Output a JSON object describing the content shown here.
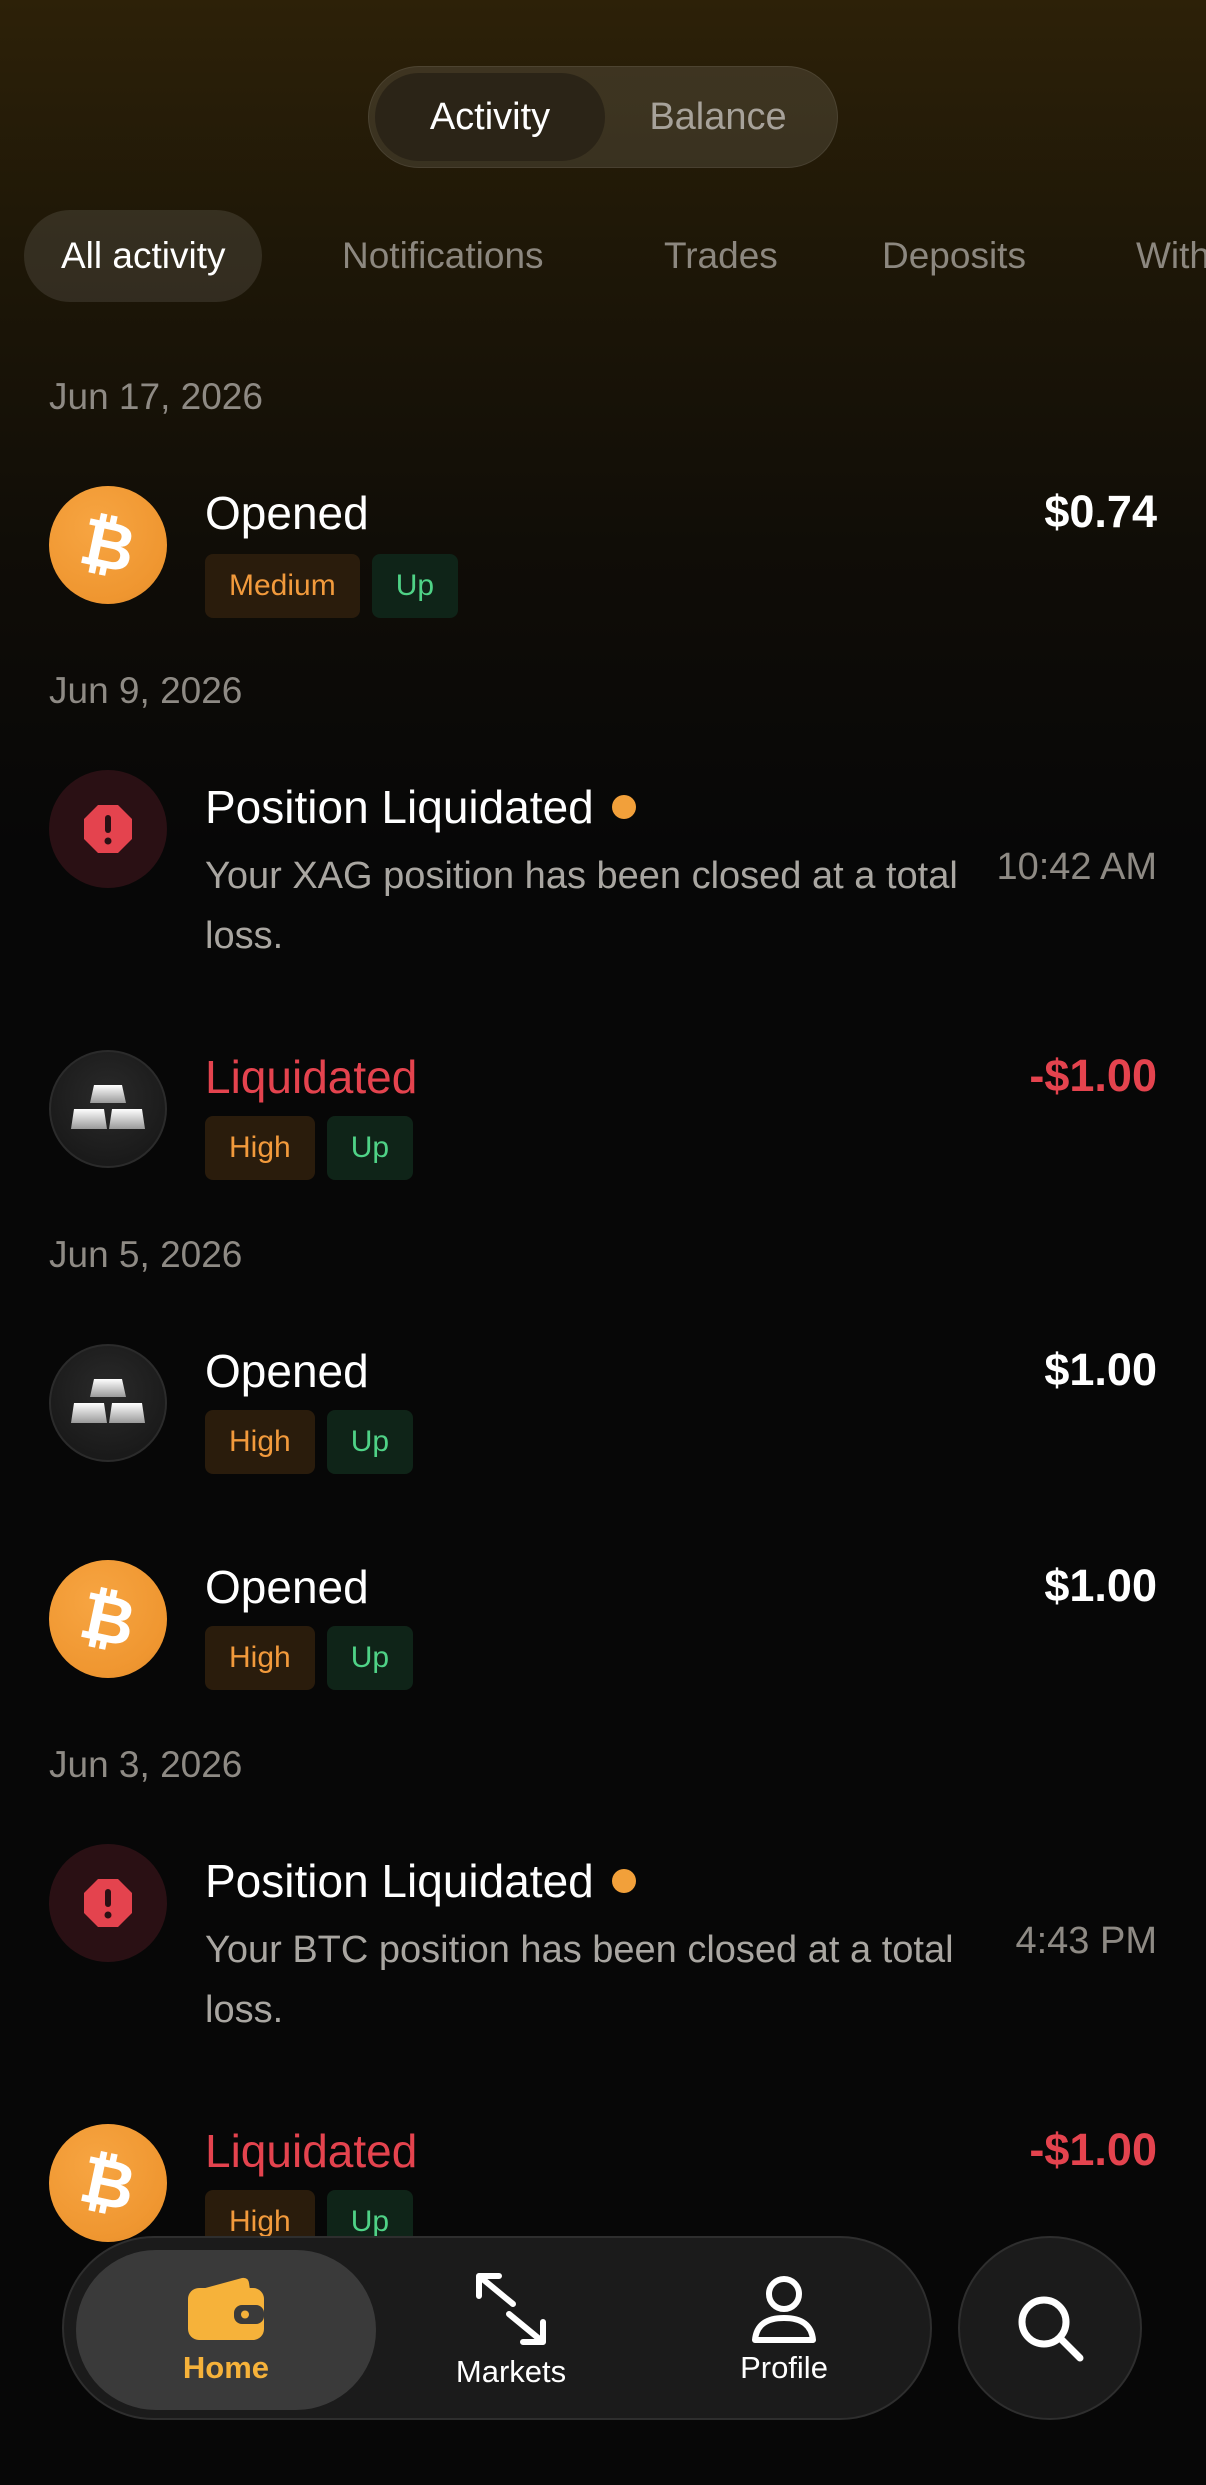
{
  "tabs": {
    "activity": "Activity",
    "balance": "Balance"
  },
  "filters": [
    "All activity",
    "Notifications",
    "Trades",
    "Deposits",
    "Withdrawals"
  ],
  "groups": [
    {
      "date": "Jun 17, 2026"
    },
    {
      "date": "Jun 9, 2026"
    },
    {
      "date": "Jun 5, 2026"
    },
    {
      "date": "Jun 3, 2026"
    }
  ],
  "items": [
    {
      "icon": "bitcoin-icon",
      "title": "Opened",
      "amount": "$0.74",
      "tags": [
        "Medium",
        "Up"
      ]
    },
    {
      "icon": "alert-icon",
      "title": "Position Liquidated",
      "description": "Your XAG position has been closed at a total loss.",
      "time": "10:42 AM",
      "unread": true
    },
    {
      "icon": "silver-bars-icon",
      "title": "Liquidated",
      "amount": "-$1.00",
      "tags": [
        "High",
        "Up"
      ]
    },
    {
      "icon": "silver-bars-icon",
      "title": "Opened",
      "amount": "$1.00",
      "tags": [
        "High",
        "Up"
      ]
    },
    {
      "icon": "bitcoin-icon",
      "title": "Opened",
      "amount": "$1.00",
      "tags": [
        "High",
        "Up"
      ]
    },
    {
      "icon": "alert-icon",
      "title": "Position Liquidated",
      "description": "Your BTC position has been closed at a total loss.",
      "time": "4:43 PM",
      "unread": true
    },
    {
      "icon": "bitcoin-icon",
      "title": "Liquidated",
      "amount": "-$1.00",
      "tags": [
        "High",
        "Up"
      ]
    }
  ],
  "nav": {
    "home": "Home",
    "markets": "Markets",
    "profile": "Profile"
  },
  "icons": {
    "search": "search-icon",
    "home": "wallet-icon",
    "markets": "arrows-icon",
    "profile": "person-icon"
  },
  "colors": {
    "accent": "#f6b23a",
    "loss": "#e4434e",
    "up": "#4fd286",
    "risk": "#f29a3c"
  }
}
